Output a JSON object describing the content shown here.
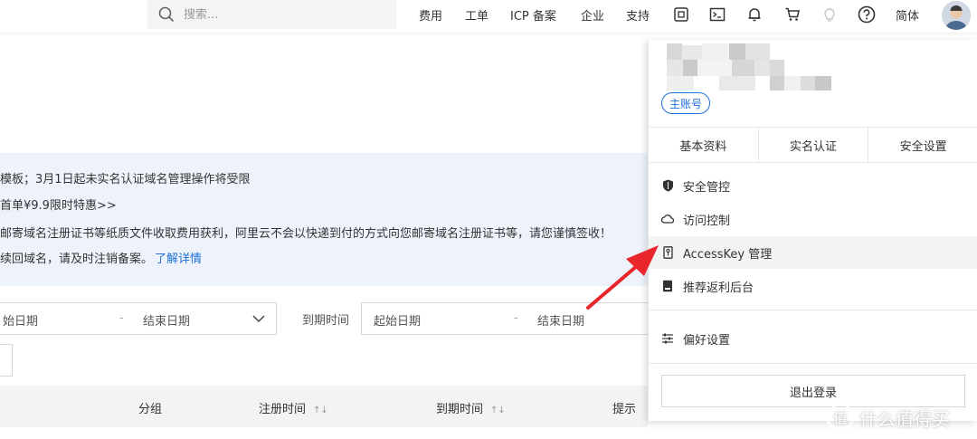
{
  "topbar": {
    "search_placeholder": "搜索...",
    "nav": [
      "费用",
      "工单",
      "ICP 备案",
      "企业",
      "支持"
    ],
    "lang": "简体",
    "icons": [
      "ai-assistant-icon",
      "terminal-icon",
      "bell-icon",
      "cart-icon",
      "lightbulb-icon",
      "help-icon"
    ]
  },
  "notice": {
    "line1": "模板；3月1日起未实名认证域名管理操作将受限",
    "line2": "首单¥9.9限时特惠>>",
    "line3": "邮寄域名注册证书等纸质文件收取费用获利，阿里云不会以快递到付的方式向您邮寄域名注册证书等，请您谨慎签收！",
    "line4_text": "续回域名，请及时注销备案。",
    "line4_link": "了解详情"
  },
  "filters": {
    "start1": "始日期",
    "end1": "结束日期",
    "expiry_label": "到期时间",
    "start2": "起始日期",
    "end2": "结束日期",
    "dash": "-"
  },
  "table": {
    "headers": [
      "分组",
      "注册时间",
      "到期时间",
      "提示"
    ],
    "sort_glyph": "↑↓"
  },
  "account_panel": {
    "badge": "主账号",
    "tabs": [
      "基本资料",
      "实名认证",
      "安全设置"
    ],
    "menu": [
      {
        "label": "安全管控",
        "icon": "shield-icon"
      },
      {
        "label": "访问控制",
        "icon": "cloud-icon"
      },
      {
        "label": "AccessKey 管理",
        "icon": "key-icon"
      },
      {
        "label": "推荐返利后台",
        "icon": "badge-icon"
      }
    ],
    "prefs": "偏好设置",
    "logout": "退出登录"
  },
  "watermark": {
    "text": "什么值得买",
    "logo": "值"
  },
  "colors": {
    "accent": "#1f6fd6",
    "arrow": "#e8262b",
    "notice_bg": "#eef3fb"
  }
}
